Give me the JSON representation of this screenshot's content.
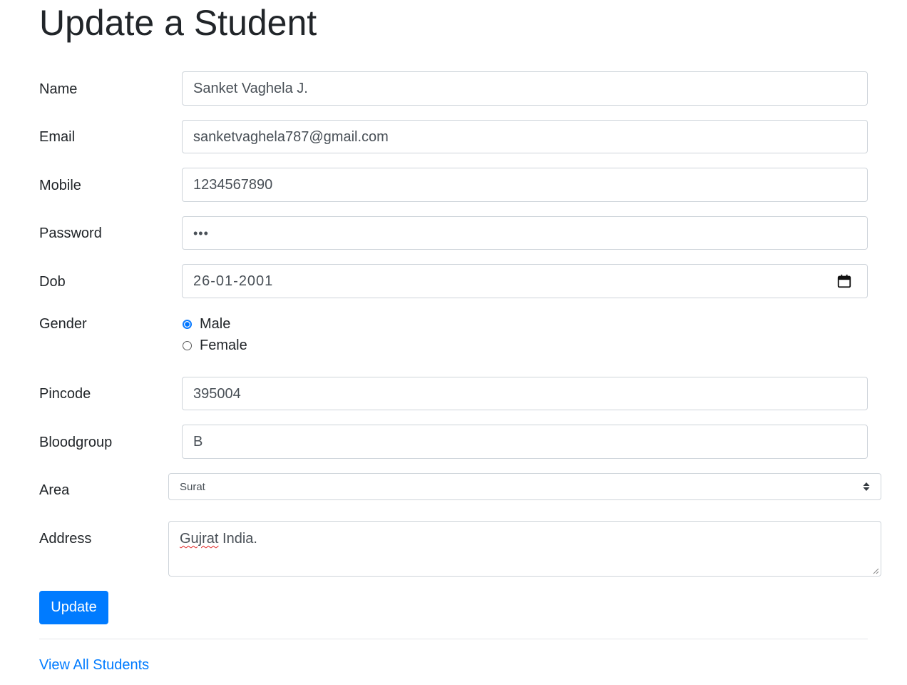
{
  "page": {
    "title": "Update a Student"
  },
  "form": {
    "name": {
      "label": "Name",
      "value": "Sanket Vaghela J."
    },
    "email": {
      "label": "Email",
      "value": "sanketvaghela787@gmail.com"
    },
    "mobile": {
      "label": "Mobile",
      "value": "1234567890"
    },
    "password": {
      "label": "Password",
      "masked_value": "•••"
    },
    "dob": {
      "label": "Dob",
      "value": "26-01-2001",
      "icon": "calendar-icon"
    },
    "gender": {
      "label": "Gender",
      "options": [
        {
          "label": "Male",
          "checked": true
        },
        {
          "label": "Female",
          "checked": false
        }
      ]
    },
    "pincode": {
      "label": "Pincode",
      "value": "395004"
    },
    "bloodgroup": {
      "label": "Bloodgroup",
      "value": "B"
    },
    "area": {
      "label": "Area",
      "selected": "Surat"
    },
    "address": {
      "label": "Address",
      "value_part1": "Gujrat",
      "value_part2": " India."
    },
    "submit_label": "Update"
  },
  "footer": {
    "link_label": "View All Students"
  },
  "colors": {
    "primary": "#007bff",
    "text": "#212529",
    "input_text": "#495057",
    "border": "#ced4da"
  }
}
